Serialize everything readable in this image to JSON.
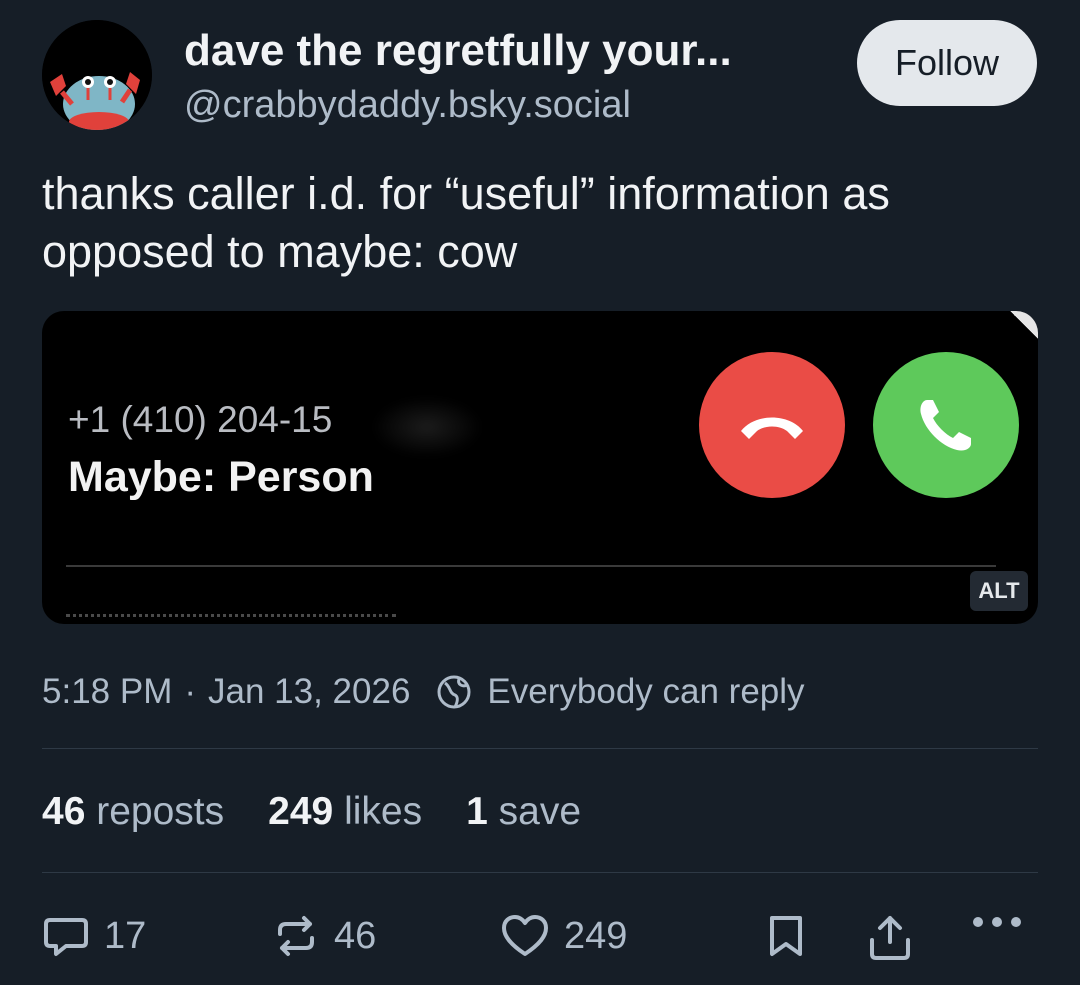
{
  "author": {
    "display_name": "dave the regretfully your...",
    "handle": "@crabbydaddy.bsky.social",
    "follow_label": "Follow"
  },
  "post": {
    "text_line1": "thanks caller i.d. for “useful” information as",
    "text_line2": "opposed to maybe: cow"
  },
  "media": {
    "phone_number": "+1 (410) 204-15",
    "caller_label": "Maybe: Person",
    "alt_label": "ALT",
    "decline_color": "#ea4c46",
    "accept_color": "#5ec95b"
  },
  "meta": {
    "time": "5:18 PM",
    "separator": "·",
    "date": "Jan 13, 2026",
    "reply_setting": "Everybody can reply"
  },
  "stats": {
    "reposts_count": "46",
    "reposts_label": "reposts",
    "likes_count": "249",
    "likes_label": "likes",
    "saves_count": "1",
    "saves_label": "save"
  },
  "actions": {
    "reply_count": "17",
    "repost_count": "46",
    "like_count": "249"
  },
  "colors": {
    "background": "#161e27",
    "text_primary": "#f1f3f5",
    "text_secondary": "#aebbc9"
  }
}
